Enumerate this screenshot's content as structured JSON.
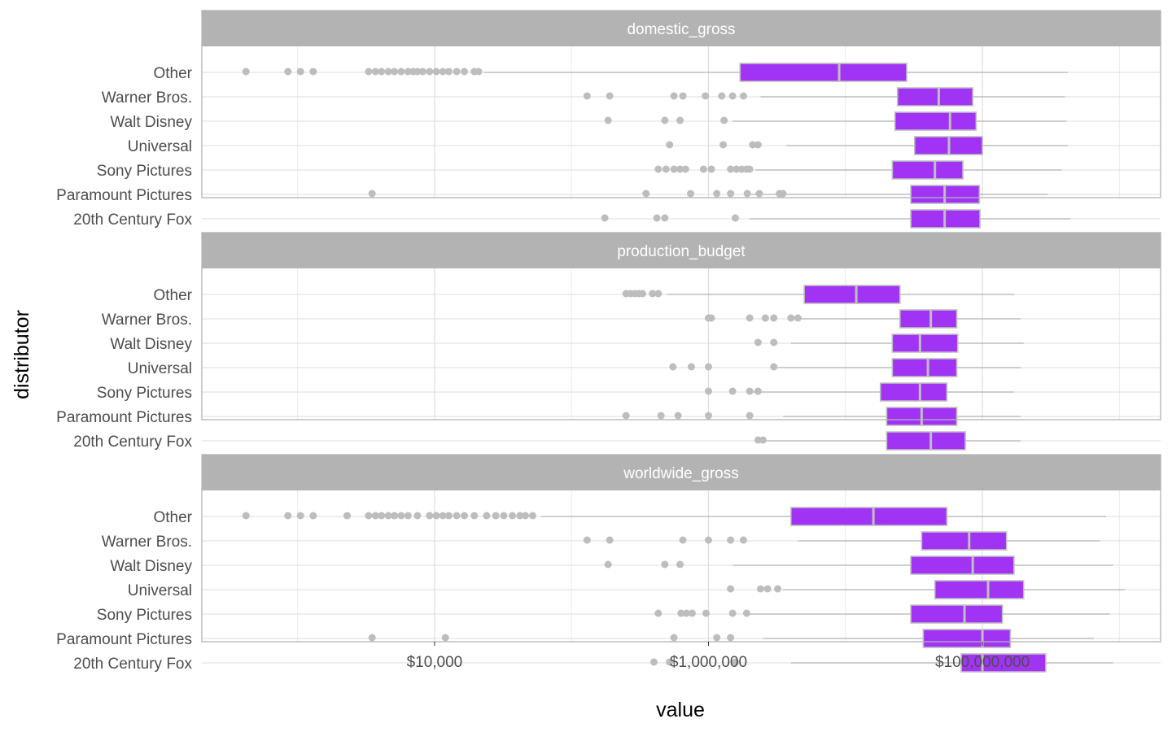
{
  "chart_data": {
    "type": "boxplot",
    "orientation": "horizontal",
    "facets": [
      "domestic_gross",
      "production_budget",
      "worldwide_gross"
    ],
    "categories": [
      "Other",
      "Warner Bros.",
      "Walt Disney",
      "Universal",
      "Sony Pictures",
      "Paramount Pictures",
      "20th Century Fox"
    ],
    "xlabel": "value",
    "ylabel": "distributor",
    "x_scale": "log10",
    "xlim": [
      200,
      2000000000
    ],
    "x_ticks": [
      10000,
      1000000,
      100000000
    ],
    "x_tick_labels": [
      "$10,000",
      "$1,000,000",
      "$100,000,000"
    ],
    "grid": true,
    "box_color": "#9b30ff",
    "box_fill": "#a133f5",
    "median_color": "#bfbfbf",
    "whisker_color": "#bdbdbd",
    "outlier_color": "#bdbdbd",
    "strip_fill": "#b3b3b3",
    "panels": [
      {
        "facet": "domestic_gross",
        "boxes": [
          {
            "distributor": "Other",
            "min": 23000,
            "q1": 1700000,
            "median": 9000000,
            "q3": 28000000,
            "max": 420000000,
            "outliers": [
              420,
              850,
              1050,
              1300,
              3300,
              3700,
              4100,
              4600,
              5100,
              5700,
              6400,
              7000,
              7500,
              8200,
              9200,
              10300,
              11500,
              12700,
              14500,
              16500,
              19500,
              21000
            ]
          },
          {
            "distributor": "Warner Bros.",
            "min": 2400000,
            "q1": 24000000,
            "median": 48000000,
            "q3": 85000000,
            "max": 400000000,
            "outliers": [
              130000,
              190000,
              560000,
              650000,
              950000,
              1250000,
              1500000,
              1800000
            ]
          },
          {
            "distributor": "Walt Disney",
            "min": 1500000,
            "q1": 23000000,
            "median": 58000000,
            "q3": 90000000,
            "max": 410000000,
            "outliers": [
              185000,
              480000,
              620000,
              1300000
            ]
          },
          {
            "distributor": "Universal",
            "min": 3700000,
            "q1": 32000000,
            "median": 57000000,
            "q3": 100000000,
            "max": 420000000,
            "outliers": [
              520000,
              1280000,
              2100000,
              2300000
            ]
          },
          {
            "distributor": "Sony Pictures",
            "min": 2200000,
            "q1": 22000000,
            "median": 45000000,
            "q3": 72000000,
            "max": 380000000,
            "outliers": [
              430000,
              490000,
              560000,
              620000,
              680000,
              920000,
              1050000,
              1450000,
              1600000,
              1750000,
              1900000,
              2000000
            ]
          },
          {
            "distributor": "Paramount Pictures",
            "min": 2000000,
            "q1": 30000000,
            "median": 53000000,
            "q3": 95000000,
            "max": 300000000,
            "outliers": [
              3500,
              350000,
              740000,
              1150000,
              1450000,
              1920000,
              2350000,
              3300000,
              3500000
            ]
          },
          {
            "distributor": "20th Century Fox",
            "min": 2000000,
            "q1": 30000000,
            "median": 53000000,
            "q3": 96000000,
            "max": 440000000,
            "outliers": [
              175000,
              420000,
              480000,
              1570000
            ]
          }
        ]
      },
      {
        "facet": "production_budget",
        "boxes": [
          {
            "distributor": "Other",
            "min": 500000,
            "q1": 5000000,
            "median": 12000000,
            "q3": 25000000,
            "max": 170000000,
            "outliers": [
              250000,
              270000,
              290000,
              310000,
              330000,
              390000,
              430000
            ]
          },
          {
            "distributor": "Warner Bros.",
            "min": 4500000,
            "q1": 25000000,
            "median": 42000000,
            "q3": 65000000,
            "max": 190000000,
            "outliers": [
              1000000,
              1050000,
              2000000,
              2600000,
              3000000,
              4000000,
              4500000
            ]
          },
          {
            "distributor": "Walt Disney",
            "min": 4000000,
            "q1": 22000000,
            "median": 35000000,
            "q3": 66000000,
            "max": 200000000,
            "outliers": [
              2300000,
              3000000
            ]
          },
          {
            "distributor": "Universal",
            "min": 2900000,
            "q1": 22000000,
            "median": 40000000,
            "q3": 65000000,
            "max": 190000000,
            "outliers": [
              550000,
              750000,
              1000000,
              3000000
            ]
          },
          {
            "distributor": "Sony Pictures",
            "min": 2000000,
            "q1": 18000000,
            "median": 35000000,
            "q3": 55000000,
            "max": 170000000,
            "outliers": [
              1000000,
              1500000,
              2000000,
              2300000
            ]
          },
          {
            "distributor": "Paramount Pictures",
            "min": 3500000,
            "q1": 20000000,
            "median": 36000000,
            "q3": 65000000,
            "max": 190000000,
            "outliers": [
              250000,
              450000,
              600000,
              1000000,
              2000000
            ]
          },
          {
            "distributor": "20th Century Fox",
            "min": 2500000,
            "q1": 20000000,
            "median": 42000000,
            "q3": 75000000,
            "max": 190000000,
            "outliers": [
              2300000,
              2500000
            ]
          }
        ]
      },
      {
        "facet": "worldwide_gross",
        "boxes": [
          {
            "distributor": "Other",
            "min": 60000,
            "q1": 4000000,
            "median": 16000000,
            "q3": 55000000,
            "max": 800000000,
            "outliers": [
              420,
              850,
              1050,
              1300,
              2300,
              3300,
              3700,
              4100,
              4600,
              5100,
              5700,
              6400,
              7500,
              9200,
              10300,
              11500,
              12700,
              14500,
              16500,
              19500,
              24000,
              28000,
              32000,
              37000,
              42000,
              46000,
              52000
            ]
          },
          {
            "distributor": "Warner Bros.",
            "min": 4500000,
            "q1": 36000000,
            "median": 80000000,
            "q3": 150000000,
            "max": 720000000,
            "outliers": [
              130000,
              190000,
              650000,
              1000000,
              1450000,
              1800000
            ]
          },
          {
            "distributor": "Walt Disney",
            "min": 1500000,
            "q1": 30000000,
            "median": 85000000,
            "q3": 170000000,
            "max": 900000000,
            "outliers": [
              185000,
              480000,
              620000
            ]
          },
          {
            "distributor": "Universal",
            "min": 3500000,
            "q1": 45000000,
            "median": 110000000,
            "q3": 200000000,
            "max": 1100000000,
            "outliers": [
              1450000,
              2400000,
              2700000,
              3200000
            ]
          },
          {
            "distributor": "Sony Pictures",
            "min": 1800000,
            "q1": 30000000,
            "median": 74000000,
            "q3": 140000000,
            "max": 850000000,
            "outliers": [
              430000,
              630000,
              690000,
              760000,
              960000,
              1500000,
              1900000
            ]
          },
          {
            "distributor": "Paramount Pictures",
            "min": 2500000,
            "q1": 37000000,
            "median": 100000000,
            "q3": 160000000,
            "max": 650000000,
            "outliers": [
              3500,
              12000,
              560000,
              1150000,
              1450000
            ]
          },
          {
            "distributor": "20th Century Fox",
            "min": 4000000,
            "q1": 70000000,
            "median": 100000000,
            "q3": 290000000,
            "max": 900000000,
            "outliers": [
              400000,
              520000,
              1570000
            ]
          }
        ]
      }
    ]
  }
}
